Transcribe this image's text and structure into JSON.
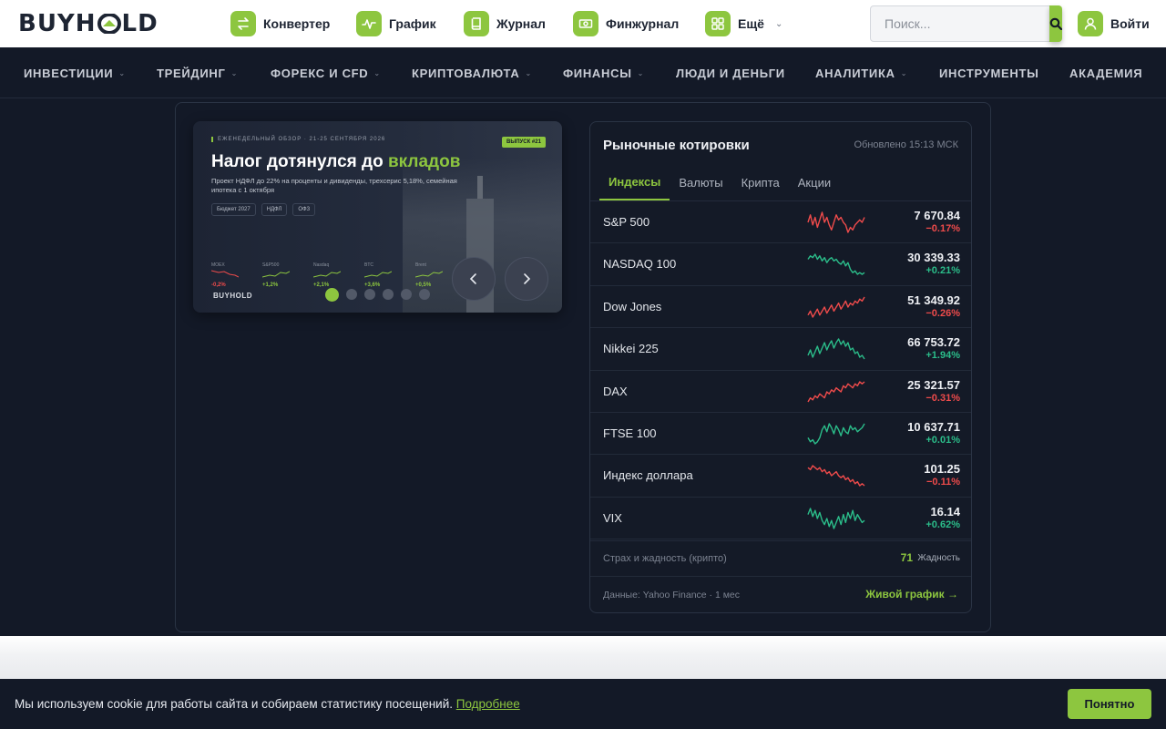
{
  "brand": {
    "logo_left": "BUYH",
    "logo_right": "LD",
    "accent": "#8dc63f"
  },
  "topnav": [
    {
      "label": "Конвертер",
      "icon": "swap-arrows-icon"
    },
    {
      "label": "График",
      "icon": "pulse-chart-icon"
    },
    {
      "label": "Журнал",
      "icon": "book-icon"
    },
    {
      "label": "Финжурнал",
      "icon": "banknote-icon"
    },
    {
      "label": "Ещё",
      "icon": "grid-icon"
    }
  ],
  "search": {
    "placeholder": "Поиск..."
  },
  "login": {
    "label": "Войти"
  },
  "mainnav": [
    {
      "label": "ИНВЕСТИЦИИ",
      "has_menu": true
    },
    {
      "label": "ТРЕЙДИНГ",
      "has_menu": true
    },
    {
      "label": "ФОРЕКС И CFD",
      "has_menu": true
    },
    {
      "label": "КРИПТОВАЛЮТА",
      "has_menu": true
    },
    {
      "label": "ФИНАНСЫ",
      "has_menu": true
    },
    {
      "label": "ЛЮДИ И ДЕНЬГИ",
      "has_menu": false
    },
    {
      "label": "АНАЛИТИКА",
      "has_menu": true
    },
    {
      "label": "ИНСТРУМЕНТЫ",
      "has_menu": false
    },
    {
      "label": "АКАДЕМИЯ",
      "has_menu": false
    }
  ],
  "banner": {
    "tag": "ЕЖЕНЕДЕЛЬНЫЙ ОБЗОР · 21-25 СЕНТЯБРЯ 2026",
    "issue": "ВЫПУСК #21",
    "title_main": "Налог дотянулся до ",
    "title_accent": "вкладов",
    "subtitle": "Проект НДФЛ до 22% на проценты и дивиденды, трехсерис 5,18%, семейная ипотека с 1 октября",
    "chips": [
      "Бюджет 2027",
      "НДФЛ",
      "ОФЗ"
    ],
    "minis": [
      {
        "name": "MOEX",
        "change": "-0,2%",
        "dir": "down"
      },
      {
        "name": "S&P500",
        "change": "+1,2%",
        "dir": "up"
      },
      {
        "name": "Nasdaq",
        "change": "+2,1%",
        "dir": "up"
      },
      {
        "name": "BTC",
        "change": "+3,6%",
        "dir": "up"
      },
      {
        "name": "Brent",
        "change": "+0,5%",
        "dir": "up"
      }
    ],
    "logo": "BUYHOLD",
    "slides_total": 6,
    "active_slide": 1
  },
  "quotes": {
    "title": "Рыночные котировки",
    "updated": "Обновлено 15:13 МСК",
    "tabs": [
      "Индексы",
      "Валюты",
      "Крипта",
      "Акции"
    ],
    "active_tab": 0,
    "rows": [
      {
        "name": "S&P 500",
        "value": "7 670.84",
        "change": "−0.17%",
        "dir": "down",
        "spark": [
          6,
          9,
          5,
          8,
          4,
          7,
          10,
          6,
          8,
          5,
          3,
          6,
          9,
          7,
          8,
          6,
          5,
          2,
          4,
          3,
          5,
          6,
          7,
          6,
          8
        ]
      },
      {
        "name": "NASDAQ 100",
        "value": "30 339.33",
        "change": "+0.21%",
        "dir": "up",
        "spark": [
          14,
          16,
          15,
          17,
          14,
          16,
          13,
          15,
          12,
          14,
          15,
          13,
          14,
          12,
          11,
          13,
          10,
          12,
          8,
          6,
          7,
          5,
          6,
          5,
          6
        ]
      },
      {
        "name": "Dow Jones",
        "value": "51 349.92",
        "change": "−0.26%",
        "dir": "down",
        "spark": [
          5,
          7,
          4,
          6,
          8,
          5,
          7,
          9,
          6,
          8,
          10,
          7,
          9,
          11,
          8,
          10,
          12,
          9,
          11,
          10,
          12,
          11,
          13,
          12,
          14
        ]
      },
      {
        "name": "Nikkei 225",
        "value": "66 753.72",
        "change": "+1.94%",
        "dir": "up",
        "spark": [
          6,
          9,
          5,
          8,
          11,
          7,
          10,
          13,
          9,
          12,
          14,
          10,
          13,
          15,
          12,
          14,
          11,
          13,
          9,
          10,
          7,
          8,
          5,
          6,
          4
        ]
      },
      {
        "name": "DAX",
        "value": "25 321.57",
        "change": "−0.31%",
        "dir": "down",
        "spark": [
          4,
          6,
          5,
          7,
          6,
          8,
          7,
          6,
          9,
          8,
          10,
          9,
          11,
          10,
          9,
          12,
          11,
          13,
          12,
          11,
          13,
          12,
          14,
          13,
          14
        ]
      },
      {
        "name": "FTSE 100",
        "value": "10 637.71",
        "change": "+0.01%",
        "dir": "up",
        "spark": [
          6,
          4,
          5,
          3,
          4,
          6,
          10,
          12,
          9,
          13,
          11,
          8,
          12,
          10,
          7,
          11,
          9,
          8,
          12,
          10,
          11,
          9,
          10,
          11,
          13
        ]
      },
      {
        "name": "Индекс доллара",
        "value": "101.25",
        "change": "−0.11%",
        "dir": "down",
        "spark": [
          14,
          13,
          15,
          14,
          13,
          14,
          12,
          13,
          11,
          12,
          10,
          11,
          12,
          10,
          9,
          10,
          8,
          9,
          7,
          8,
          6,
          7,
          5,
          6,
          5
        ]
      },
      {
        "name": "VIX",
        "value": "16.14",
        "change": "+0.62%",
        "dir": "up",
        "spark": [
          10,
          13,
          9,
          12,
          8,
          11,
          7,
          5,
          8,
          4,
          7,
          3,
          6,
          9,
          5,
          10,
          6,
          11,
          8,
          12,
          7,
          10,
          8,
          6,
          7
        ]
      }
    ],
    "fear_greed_label": "Страх и жадность (крипто)",
    "fear_greed_value": "71",
    "fear_greed_status": "Жадность",
    "source": "Данные: Yahoo Finance · 1 мес",
    "live_link": "Живой график →"
  },
  "cookie": {
    "text": "Мы используем cookie для работы сайта и собираем статистику посещений.",
    "link": "Подробнее",
    "button": "Понятно"
  },
  "colors": {
    "up": "#2bbd8a",
    "down": "#ef4b4b",
    "bg": "#131927"
  }
}
